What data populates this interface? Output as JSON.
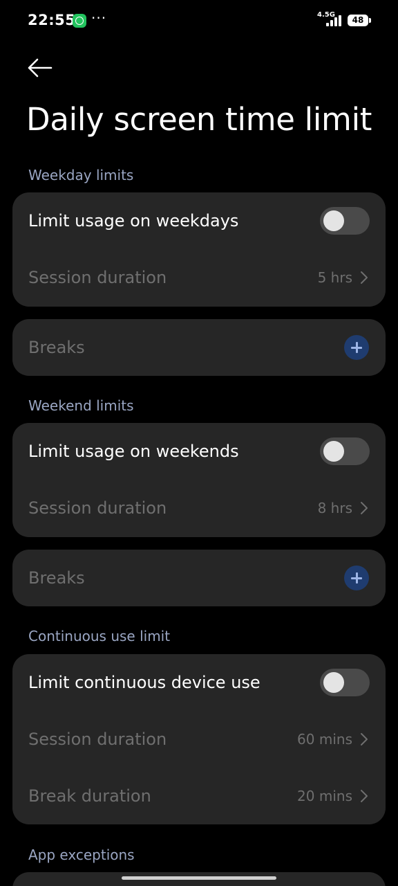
{
  "status_bar": {
    "time": "22:55",
    "more": "···",
    "network": "4.5G",
    "battery": "48",
    "notification_icon": "whatsapp-icon"
  },
  "header": {
    "back_icon": "arrow-left-icon",
    "title": "Daily screen time limit"
  },
  "weekday": {
    "section_label": "Weekday limits",
    "toggle_label": "Limit usage on weekdays",
    "toggle_on": false,
    "session_label": "Session duration",
    "session_value": "5 hrs",
    "breaks_label": "Breaks"
  },
  "weekend": {
    "section_label": "Weekend limits",
    "toggle_label": "Limit usage on weekends",
    "toggle_on": false,
    "session_label": "Session duration",
    "session_value": "8 hrs",
    "breaks_label": "Breaks"
  },
  "continuous": {
    "section_label": "Continuous use limit",
    "toggle_label": "Limit continuous device use",
    "toggle_on": false,
    "session_label": "Session duration",
    "session_value": "60 mins",
    "break_label": "Break duration",
    "break_value": "20 mins"
  },
  "exceptions": {
    "section_label": "App exceptions"
  },
  "colors": {
    "background": "#000000",
    "card": "#262626",
    "section_label": "#9aa6c3",
    "disabled_text": "#6f6f6f",
    "add_button": "#1f3c6f"
  }
}
